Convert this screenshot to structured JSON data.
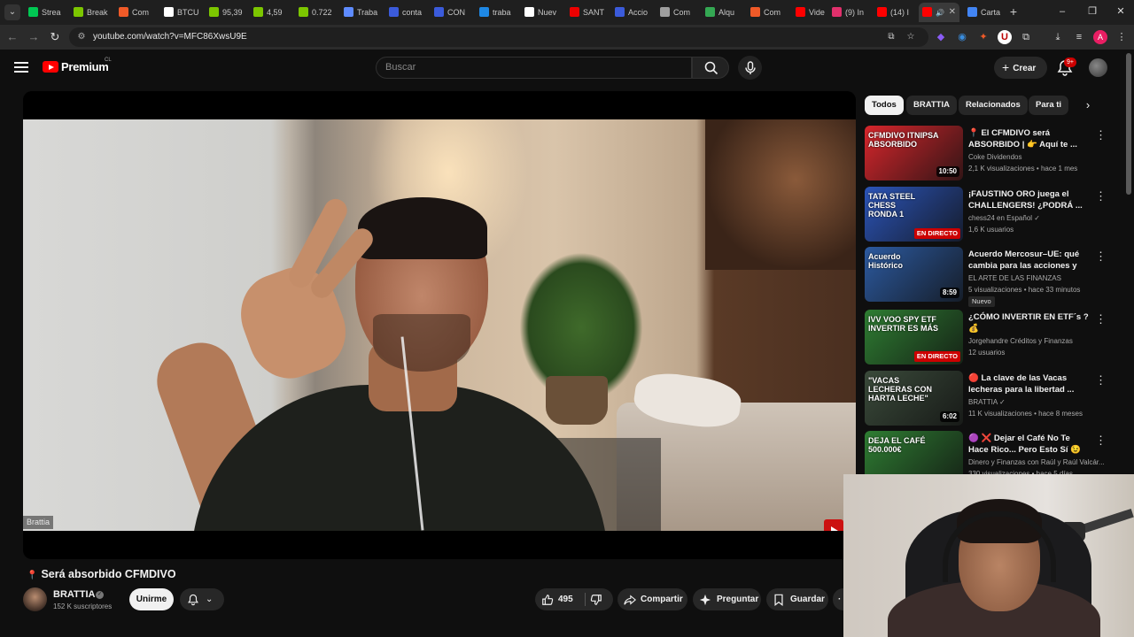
{
  "browser": {
    "tabs": [
      {
        "label": "Strea",
        "color": "#00c853"
      },
      {
        "label": "Break",
        "color": "#7cc600"
      },
      {
        "label": "Com",
        "color": "#f05a28"
      },
      {
        "label": "BTCU",
        "color": "#ffffff"
      },
      {
        "label": "95,39",
        "color": "#7cc600"
      },
      {
        "label": "4,59",
        "color": "#7cc600"
      },
      {
        "label": "0.722",
        "color": "#7cc600"
      },
      {
        "label": "Traba",
        "color": "#5e8bff"
      },
      {
        "label": "conta",
        "color": "#3b5bdb"
      },
      {
        "label": "CON",
        "color": "#3b5bdb"
      },
      {
        "label": "traba",
        "color": "#1e88e5"
      },
      {
        "label": "Nuev",
        "color": "#ffffff"
      },
      {
        "label": "SANT",
        "color": "#ec0000"
      },
      {
        "label": "Accio",
        "color": "#3b5bdb"
      },
      {
        "label": "Com",
        "color": "#9e9e9e"
      },
      {
        "label": "Alqu",
        "color": "#34a853"
      },
      {
        "label": "Com",
        "color": "#f05a28"
      },
      {
        "label": "Vide",
        "color": "#ff0000"
      },
      {
        "label": "(9) In",
        "color": "#e1306c"
      },
      {
        "label": "(14) I",
        "color": "#ff0000"
      },
      {
        "label": "",
        "color": "#ff0000"
      },
      {
        "label": "Carta",
        "color": "#4285f4"
      }
    ],
    "url": "youtube.com/watch?v=MFC86XwsU9E",
    "profile_initial": "A",
    "ext_initial": "U"
  },
  "header": {
    "logo_text": "Premium",
    "region": "CL",
    "search_placeholder": "Buscar",
    "create_label": "Crear",
    "notif_count": "9+"
  },
  "video": {
    "watermark": "Brattia",
    "title": "Será absorbido CFMDIVO",
    "channel": "BRATTIA",
    "subscribers": "152 K suscriptores",
    "join_label": "Unirme",
    "likes": "495",
    "share_label": "Compartir",
    "ask_label": "Preguntar",
    "save_label": "Guardar"
  },
  "sidebar": {
    "chips": [
      "Todos",
      "BRATTIA",
      "Relacionados",
      "Para ti"
    ],
    "recs": [
      {
        "title": "📍 El CFMDIVO será ABSORBIDO | 👉 Aquí te ...",
        "channel": "Coke Dividendos",
        "meta": "2,1 K visualizaciones • hace 1 mes",
        "duration": "10:50",
        "thumb_text": "CFMDIVO ITNIPSA\nABSORBIDO",
        "thumb_bg": "#d7262c",
        "verified": false
      },
      {
        "title": "¡FAUSTINO ORO juega el CHALLENGERS! ¿PODRÁ ...",
        "channel": "chess24 en Español",
        "meta": "1,6 K usuarios",
        "live": "EN DIRECTO",
        "thumb_text": "TATA STEEL CHESS\nRONDA 1",
        "thumb_bg": "#2b54b8",
        "verified": true
      },
      {
        "title": "Acuerdo Mercosur–UE: qué cambia para las acciones y los...",
        "channel": "EL ARTE DE LAS FINANZAS",
        "meta": "5 visualizaciones • hace 33 minutos",
        "duration": "8:59",
        "badge": "Nuevo",
        "thumb_text": "Acuerdo\nHistórico",
        "thumb_bg": "#2c5aa0",
        "verified": false
      },
      {
        "title": "¿CÓMO INVERTIR EN ETF´s ? 💰",
        "channel": "Jorgehandre Créditos y Finanzas",
        "meta": "12 usuarios",
        "live": "EN DIRECTO",
        "thumb_text": "IVV VOO SPY ETF\nINVERTIR ES MÁS",
        "thumb_bg": "#2e7d32",
        "verified": false
      },
      {
        "title": "🔴 La clave de las Vacas lecheras para la libertad ...",
        "channel": "BRATTIA",
        "meta": "11 K visualizaciones • hace 8 meses",
        "duration": "6:02",
        "thumb_text": "\"VACAS LECHERAS CON HARTA LECHE\"",
        "thumb_bg": "#3a4a3a",
        "verified": true
      },
      {
        "title": "🟣 ❌ Dejar el Café No Te Hace Rico... Pero Esto Sí 😉",
        "channel": "Dinero y Finanzas con Raúl y Raúl Valcár...",
        "meta": "330 visualizaciones • hace 5 días",
        "thumb_text": "DEJA EL CAFÉ\n500.000€",
        "thumb_bg": "#2e7d32",
        "verified": false
      }
    ]
  }
}
